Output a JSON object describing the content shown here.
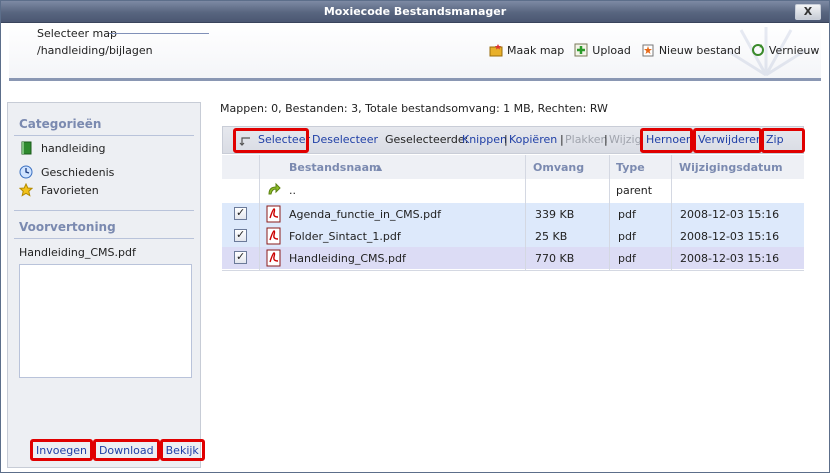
{
  "window": {
    "title": "Moxiecode Bestandsmanager",
    "close_label": "X"
  },
  "header": {
    "select_map_label": "Selecteer map",
    "path": "/handleiding/bijlagen",
    "toolbar": [
      {
        "label": "Maak map",
        "icon": "new-folder-icon"
      },
      {
        "label": "Upload",
        "icon": "upload-icon"
      },
      {
        "label": "Nieuw bestand",
        "icon": "new-file-icon"
      },
      {
        "label": "Vernieuw",
        "icon": "refresh-icon"
      }
    ]
  },
  "sidebar": {
    "categories_title": "Categorieën",
    "categories": [
      {
        "label": "handleiding",
        "icon": "book-icon"
      },
      {
        "label": "Geschiedenis",
        "icon": "clock-icon"
      },
      {
        "label": "Favorieten",
        "icon": "star-icon"
      }
    ],
    "preview_title": "Voorvertoning",
    "preview_file": "Handleiding_CMS.pdf",
    "preview_actions": [
      "Invoegen",
      "Download",
      "Bekijk"
    ]
  },
  "main": {
    "info": "Mappen: 0, Bestanden: 3, Totale bestandsomvang: 1 MB, Rechten: RW",
    "actions": {
      "select": "Selecteer",
      "deselect": "Deselecteer",
      "selected_label": "Geselecteerde:",
      "cut": "Knippen",
      "separator": "|",
      "copy": "Kopiëren",
      "paste": "Plakken",
      "edit": "Wijzig",
      "rename": "Hernoem",
      "delete": "Verwijderen",
      "zip": "Zip"
    },
    "columns": {
      "name": "Bestandsnaam",
      "sort_indicator": "▲",
      "size": "Omvang",
      "type": "Type",
      "date": "Wijzigingsdatum"
    },
    "parent_row": {
      "name": "..",
      "type": "parent"
    },
    "files": [
      {
        "name": "Agenda_functie_in_CMS.pdf",
        "size": "339 KB",
        "type": "pdf",
        "date": "2008-12-03 15:16",
        "checked": true
      },
      {
        "name": "Folder_Sintact_1.pdf",
        "size": "25 KB",
        "type": "pdf",
        "date": "2008-12-03 15:16",
        "checked": true
      },
      {
        "name": "Handleiding_CMS.pdf",
        "size": "770 KB",
        "type": "pdf",
        "date": "2008-12-03 15:16",
        "checked": true
      }
    ]
  },
  "colors": {
    "title_bar": "#58657f",
    "link": "#1f3fa6",
    "highlight_box": "#e00000",
    "section_title": "#7b8ab0",
    "selected_row": "#dde9fb"
  }
}
